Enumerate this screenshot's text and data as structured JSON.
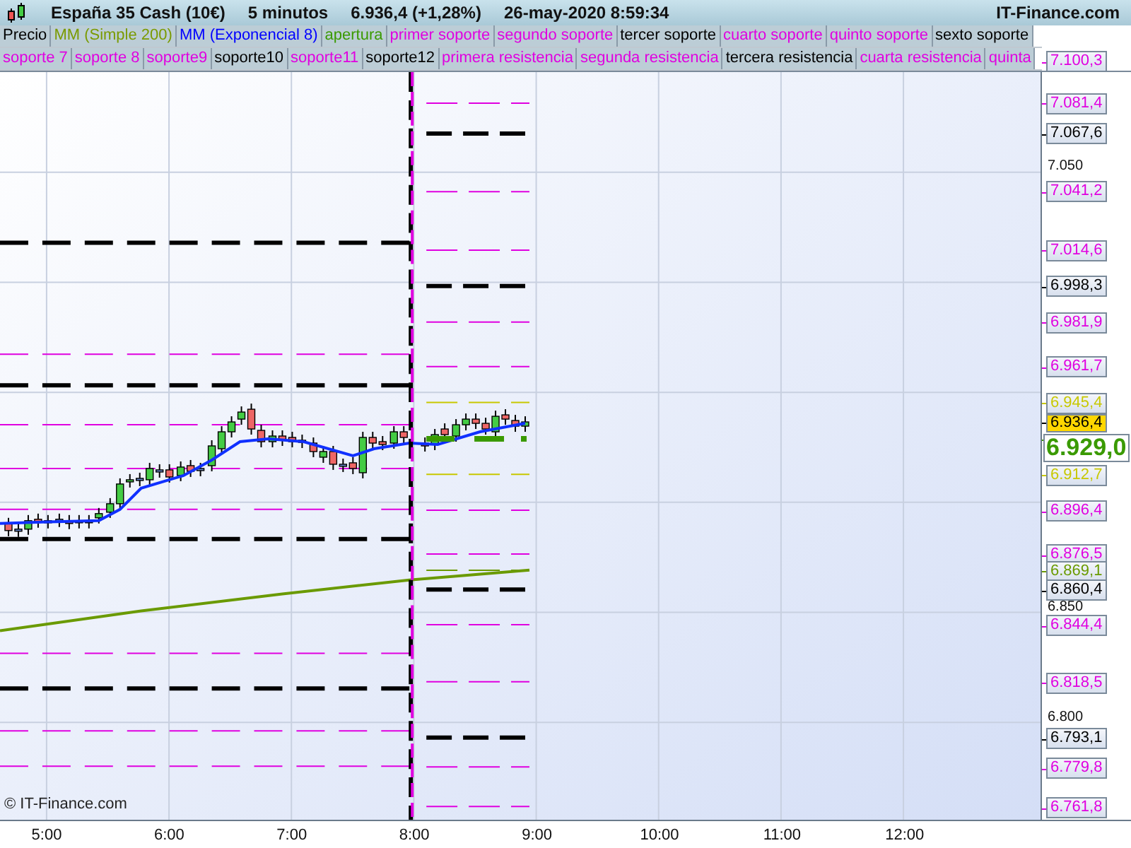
{
  "header": {
    "title": "España 35 Cash (10€)",
    "interval": "5 minutos",
    "quote": "6.936,4 (+1,28%)",
    "datetime": "26-may-2020 8:59:34",
    "brand": "IT-Finance.com"
  },
  "legend_rows": [
    [
      {
        "text": "Precio",
        "color": "#000000"
      },
      {
        "text": "MM (Simple 200)",
        "color": "#7a9a00"
      },
      {
        "text": "MM (Exponencial 8)",
        "color": "#0000ff"
      },
      {
        "text": "apertura",
        "color": "#3a9a00"
      },
      {
        "text": "primer soporte",
        "color": "#e000e0"
      },
      {
        "text": "segundo soporte",
        "color": "#e000e0"
      },
      {
        "text": "tercer soporte",
        "color": "#000000"
      },
      {
        "text": "cuarto soporte",
        "color": "#e000e0"
      },
      {
        "text": "quinto soporte",
        "color": "#e000e0"
      },
      {
        "text": "sexto soporte",
        "color": "#000000"
      }
    ],
    [
      {
        "text": "soporte 7",
        "color": "#e000e0"
      },
      {
        "text": "soporte 8",
        "color": "#e000e0"
      },
      {
        "text": "soporte9",
        "color": "#e000e0"
      },
      {
        "text": "soporte10",
        "color": "#000000"
      },
      {
        "text": "soporte11",
        "color": "#e000e0"
      },
      {
        "text": "soporte12",
        "color": "#000000"
      },
      {
        "text": "primera resistencia",
        "color": "#e000e0"
      },
      {
        "text": "segunda resistencia",
        "color": "#e000e0"
      },
      {
        "text": "tercera resistencia",
        "color": "#000000"
      },
      {
        "text": "cuarta resistencia",
        "color": "#e000e0"
      },
      {
        "text": "quinta",
        "color": "#e000e0"
      }
    ]
  ],
  "price_axis": {
    "ticks": [
      "7.050",
      "6.850",
      "6.800"
    ],
    "tags": [
      {
        "text": "7.100,3",
        "kind": "tag",
        "color": "#e000e0"
      },
      {
        "text": "7.081,4",
        "kind": "tag",
        "color": "#e000e0"
      },
      {
        "text": "7.067,6",
        "kind": "tag",
        "color": "#000000"
      },
      {
        "text": "7.041,2",
        "kind": "tag",
        "color": "#e000e0"
      },
      {
        "text": "7.014,6",
        "kind": "tag",
        "color": "#e000e0"
      },
      {
        "text": "6.998,3",
        "kind": "tag",
        "color": "#000000"
      },
      {
        "text": "6.981,9",
        "kind": "tag",
        "color": "#e000e0"
      },
      {
        "text": "6.961,7",
        "kind": "tag",
        "color": "#e000e0"
      },
      {
        "text": "6.945,4",
        "kind": "tag",
        "color": "#c8c800"
      },
      {
        "text": "6.936,4",
        "kind": "current",
        "color": "#000000"
      },
      {
        "text": "6.929,0",
        "kind": "large",
        "color": "#3a9a00"
      },
      {
        "text": "6.912,7",
        "kind": "tag",
        "color": "#c8c800"
      },
      {
        "text": "6.896,4",
        "kind": "tag",
        "color": "#e000e0"
      },
      {
        "text": "6.876,5",
        "kind": "tag",
        "color": "#e000e0"
      },
      {
        "text": "6.869,1",
        "kind": "tag",
        "color": "#6a9a00"
      },
      {
        "text": "6.860,4",
        "kind": "tag",
        "color": "#000000"
      },
      {
        "text": "6.844,4",
        "kind": "tag",
        "color": "#e000e0"
      },
      {
        "text": "6.818,5",
        "kind": "tag",
        "color": "#e000e0"
      },
      {
        "text": "6.793,1",
        "kind": "tag",
        "color": "#000000"
      },
      {
        "text": "6.779,8",
        "kind": "tag",
        "color": "#e000e0"
      },
      {
        "text": "6.761,8",
        "kind": "tag",
        "color": "#e000e0"
      }
    ]
  },
  "time_axis": [
    "5:00",
    "6:00",
    "7:00",
    "8:00",
    "9:00",
    "10:00",
    "11:00",
    "12:00"
  ],
  "copyright": "© IT-Finance.com"
}
